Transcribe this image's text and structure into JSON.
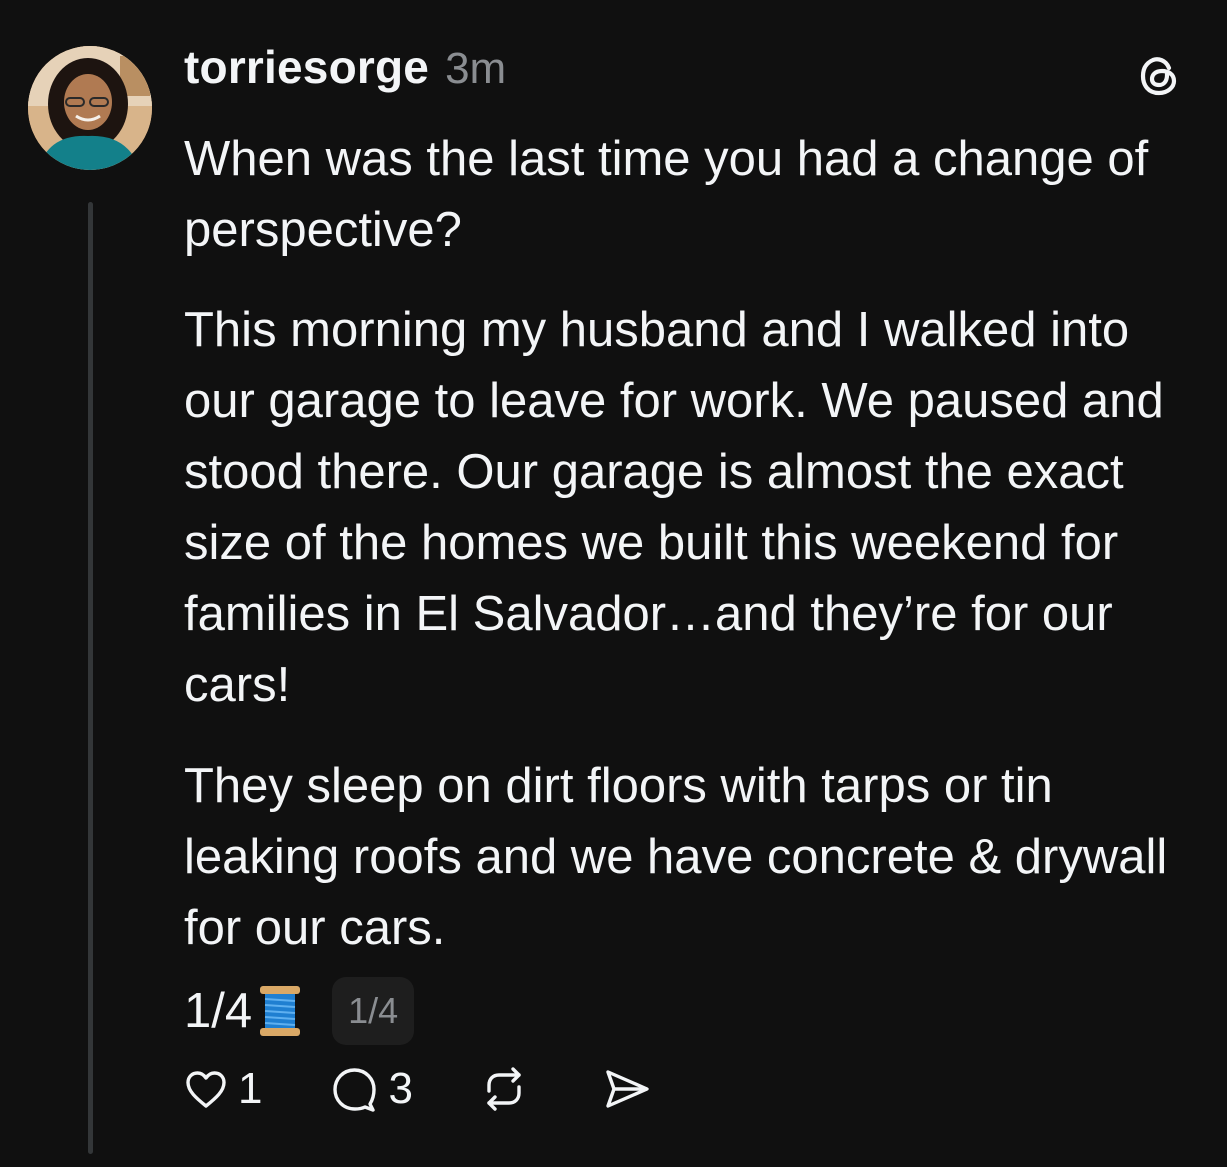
{
  "post": {
    "username": "torriesorge",
    "timestamp": "3m",
    "paragraphs": [
      "When was the last time you had a change of perspective?",
      "This morning my husband and I walked into our garage to leave for work. We paused and stood there. Our garage is almost the exact size of the homes we built this weekend for families in El Salvador…and they’re for our cars!",
      "They sleep on dirt floors with tarps or tin leaking roofs and we have concrete & drywall for our cars."
    ],
    "thread_counter": "1/4",
    "thread_emoji": "spool-of-thread",
    "page_indicator": "1/4"
  },
  "actions": {
    "likes": "1",
    "replies": "3"
  },
  "icons": {
    "avatar": "avatar",
    "app_logo": "threads-logo-icon",
    "like": "heart-icon",
    "reply": "comment-bubble-icon",
    "repost": "repost-icon",
    "share": "send-icon"
  },
  "colors": {
    "background": "#101010",
    "primary_text": "#f3f5f7",
    "secondary_text": "#8a8d91",
    "thread_line": "#333638",
    "pill_bg": "#1e1e1e"
  }
}
